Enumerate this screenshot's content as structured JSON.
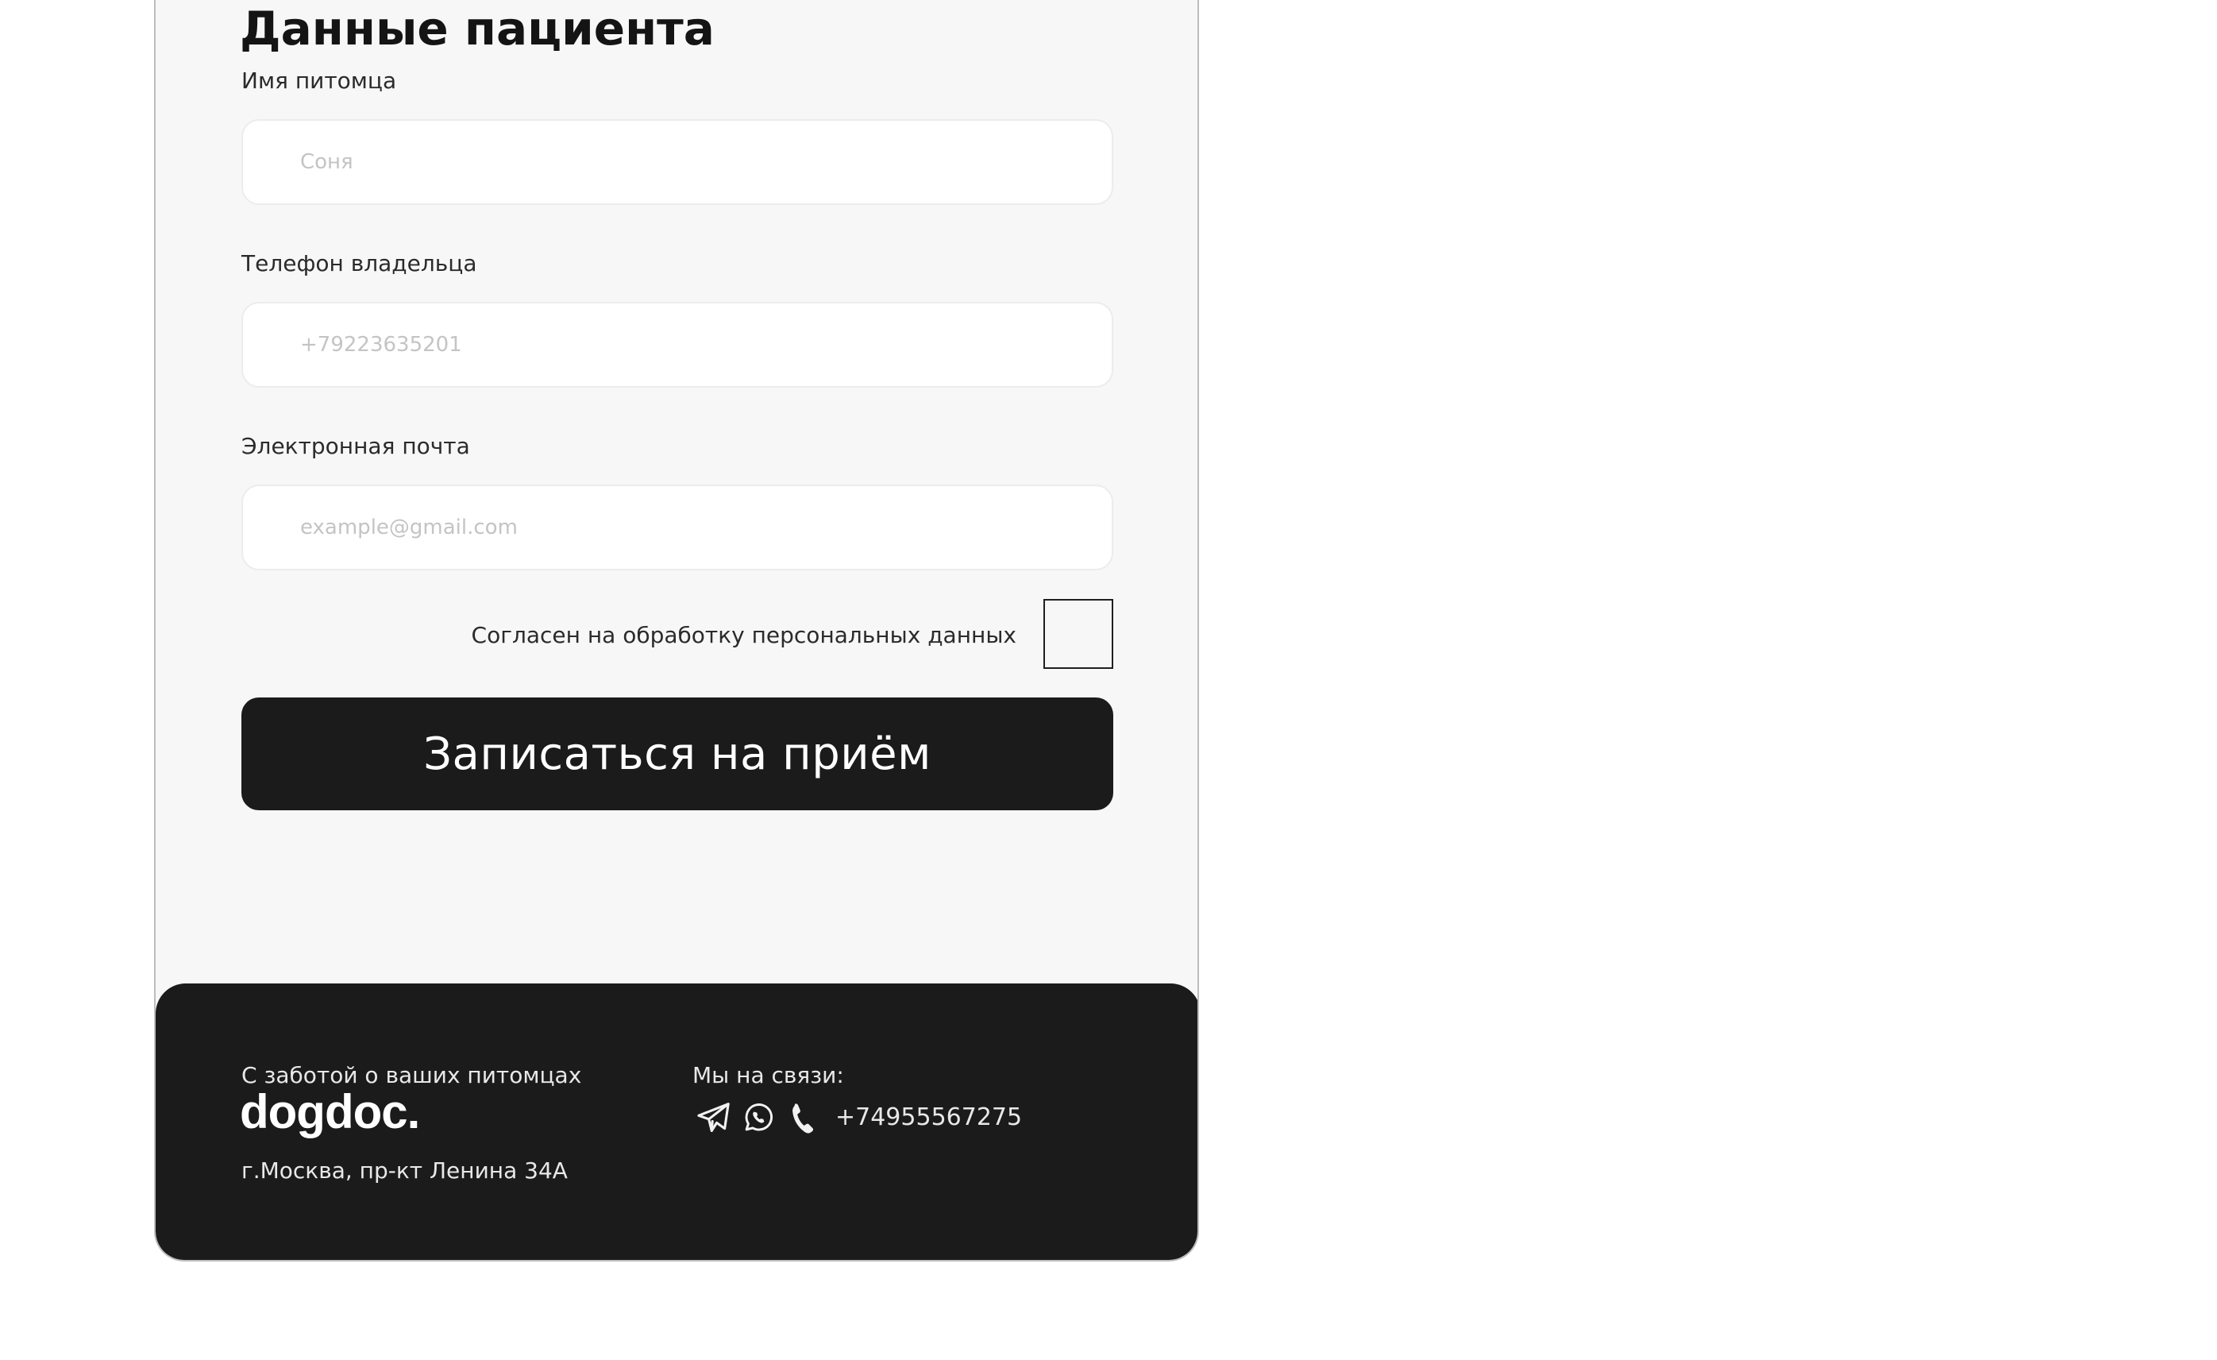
{
  "form": {
    "title": "Данные пациента",
    "pet_name": {
      "label": "Имя питомца",
      "placeholder": "Соня"
    },
    "owner_phone": {
      "label": "Телефон владельца",
      "placeholder": "+79223635201"
    },
    "email": {
      "label": "Электронная почта",
      "placeholder": "example@gmail.com"
    },
    "consent": {
      "label": "Согласен на обработку персональных данных",
      "checked": false
    },
    "submit_label": "Записаться на приём"
  },
  "footer": {
    "tagline": "С заботой о ваших питомцах",
    "logo": "dogdoc.",
    "address": "г.Москва, пр-кт Ленина 34А",
    "contacts_heading": "Мы на связи:",
    "icons": [
      "telegram-icon",
      "whatsapp-icon",
      "phone-icon"
    ],
    "phone": "+74955567275"
  },
  "colors": {
    "card_background": "#f7f7f7",
    "footer_background": "#1b1b1b",
    "button_background": "#1b1b1b",
    "button_text": "#ffffff",
    "placeholder": "#c4c4c4"
  }
}
